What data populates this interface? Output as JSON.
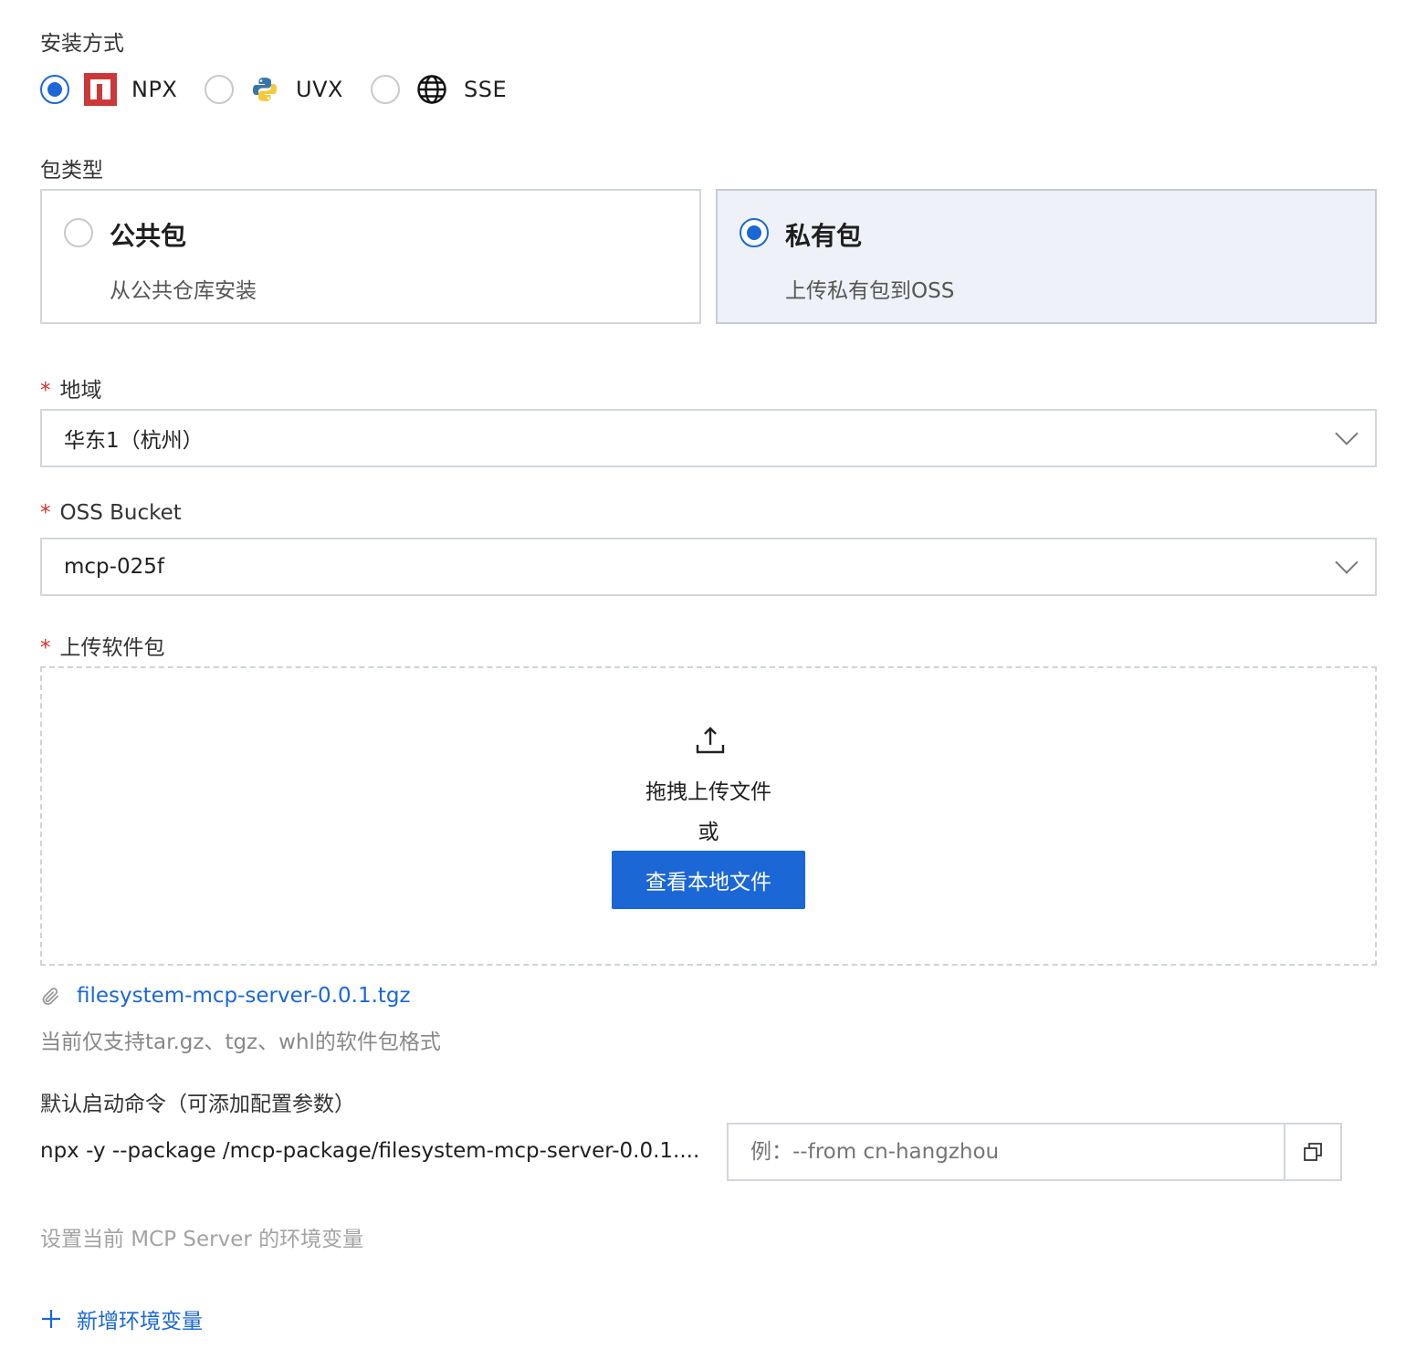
{
  "install": {
    "label": "安装方式",
    "options": [
      {
        "label": "NPX",
        "icon": "npm-icon",
        "checked": true
      },
      {
        "label": "UVX",
        "icon": "python-icon",
        "checked": false
      },
      {
        "label": "SSE",
        "icon": "globe-icon",
        "checked": false
      }
    ]
  },
  "package_type": {
    "label": "包类型",
    "public": {
      "title": "公共包",
      "desc": "从公共仓库安装",
      "checked": false
    },
    "private": {
      "title": "私有包",
      "desc": "上传私有包到OSS",
      "checked": true
    }
  },
  "region": {
    "required_mark": "*",
    "label": "地域",
    "value": "华东1（杭州）"
  },
  "bucket": {
    "required_mark": "*",
    "label": "OSS Bucket",
    "value": "mcp-025f"
  },
  "upload": {
    "required_mark": "*",
    "label": "上传软件包",
    "drag_text": "拖拽上传文件",
    "or_text": "或",
    "browse_label": "查看本地文件",
    "file_name": "filesystem-mcp-server-0.0.1.tgz",
    "hint": "当前仅支持tar.gz、tgz、whl的软件包格式"
  },
  "command": {
    "label": "默认启动命令（可添加配置参数）",
    "value": "npx -y --package /mcp-package/filesystem-mcp-server-0.0.1....",
    "args_placeholder": "例：--from cn-hangzhou"
  },
  "env": {
    "hint": "设置当前 MCP Server 的环境变量",
    "add_label": "新增环境变量"
  },
  "colors": {
    "primary": "#1b67d6",
    "required": "#d93026",
    "selected_card_bg": "#eef1f7",
    "npm_red": "#cb3837"
  }
}
